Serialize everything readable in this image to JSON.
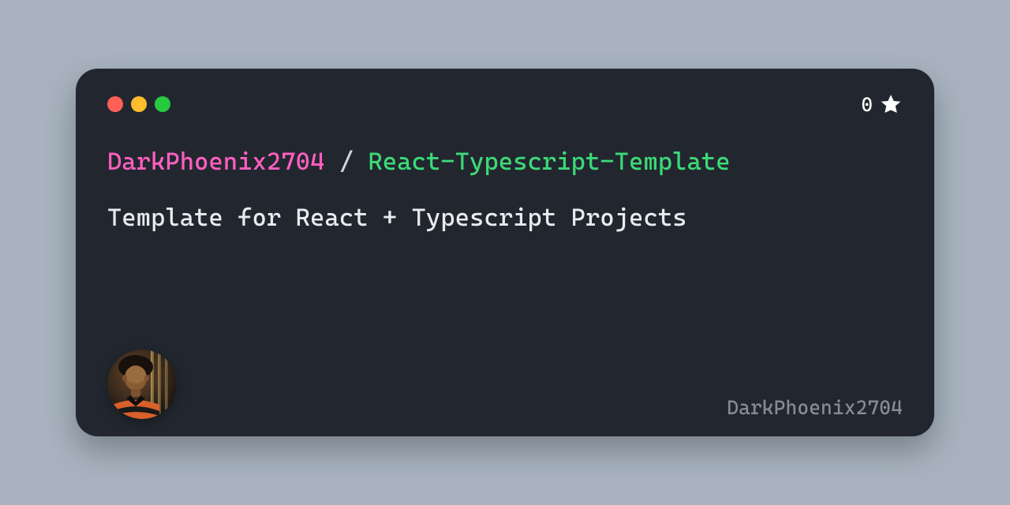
{
  "owner": "DarkPhoenix2704",
  "separator": " / ",
  "repo": "React-Typescript-Template",
  "description": "Template for React + Typescript Projects",
  "stars": "0",
  "username": "DarkPhoenix2704"
}
